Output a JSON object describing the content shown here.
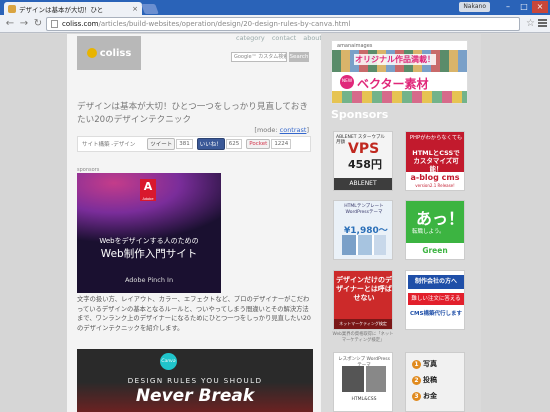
{
  "browser": {
    "tab_title": "デザインは基本が大切！ひと",
    "tab_close": "×",
    "user": "Nakano",
    "win_min": "–",
    "win_max": "□",
    "win_close": "×",
    "back": "←",
    "forward": "→",
    "reload": "↻",
    "url_host": "coliss.com",
    "url_path": "/articles/build-websites/operation/design/20-design-rules-by-canva.html",
    "star": "☆"
  },
  "site": {
    "logo_text": "coliss",
    "nav": [
      "category",
      "contact",
      "about"
    ],
    "search_placeholder": "Google™ カスタム検索",
    "search_button": "Search"
  },
  "article": {
    "title": "デザインは基本が大切！ひとつ一つをしっかり見直しておきたい20のデザインテクニック",
    "mode_prefix": "[mode: ",
    "mode_link": "contrast",
    "mode_suffix": "]",
    "category": "サイト構築 -デザイン",
    "tweet_label": "ツイート",
    "tweet_count": "381",
    "like_label": "いいね！",
    "like_count": "625",
    "pocket_label": "Pocket",
    "pocket_count": "1224",
    "sponsors_label": "sponsors",
    "ad_adobe": {
      "logo": "A",
      "logo_sub": "Adobe",
      "line1": "Webをデザインする人のための",
      "line2": "Web制作入門サイト",
      "line3": "Adobe Pinch In"
    },
    "body": "文字の扱い方、レイアウト、カラー、エフェクトなど、プロのデザイナーがこだわっているデザインの基本となるルールと、ついやってしまう間違いとその解決方法まで、ワンランク上のデザイナーになるためにひとつ一つをしっかり見直したい20のデザインテクニックを紹介します。",
    "canva": {
      "logo": "Canva",
      "line1": "DESIGN RULES YOU SHOULD",
      "line2": "Never Break"
    }
  },
  "sidebar": {
    "ad_wide": {
      "top": "amanaimages",
      "line1": "オリジナル作品満載！",
      "badge": "NEW",
      "line2": "ベクター素材"
    },
    "sponsors_heading": "Sponsors",
    "ads": {
      "vps": {
        "top": "ABLENET スターウブル",
        "note": "月額",
        "big": "VPS",
        "price": "458円",
        "footer": "ABLENET"
      },
      "blog": {
        "line1": "PHPがわからなくても",
        "line2": "HTMLとCSSで カスタマイズ可能！",
        "footer": "a-blog cms",
        "footer_sub": "version2.1 Release!"
      },
      "wp": {
        "line1": "HTMLテンプレート WordPressテーマ",
        "price": "¥1,980〜"
      },
      "green": {
        "line1": "あっ！",
        "line2": "転職しよう。",
        "footer": "Green"
      },
      "marketer": {
        "line1": "デザインだけのデザイナーとは呼ばせない",
        "footer": "ネットマーケティング検定"
      },
      "marketer_caption": "Web業界の資格取得に「ネットマーケティング検定」",
      "cms": {
        "line1": "制作会社の方へ",
        "line2": "難しい注文に答える",
        "line3": "CMS構築代行します"
      },
      "lesson": {
        "line1": "レスポンシブ WordPressテーマ",
        "line2": "HTML&CSS"
      },
      "photo": {
        "row1": "写真",
        "row2": "投稿",
        "row3": "お金"
      }
    }
  }
}
